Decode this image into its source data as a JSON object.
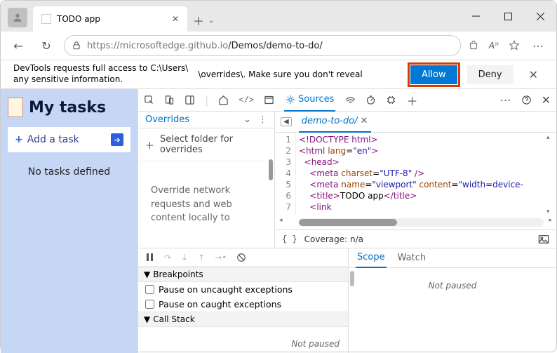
{
  "tab": {
    "title": "TODO app"
  },
  "url": {
    "prefix": "https://microsoftedge.github.io",
    "path": "/Demos/demo-to-do/"
  },
  "permission": {
    "line1": "DevTools requests full access to C:\\Users\\",
    "line2": "any sensitive information.",
    "line3": "\\overrides\\. Make sure you don't reveal",
    "allow": "Allow",
    "deny": "Deny"
  },
  "app": {
    "title": "My tasks",
    "add_label": "Add a task",
    "empty": "No tasks defined"
  },
  "devtools": {
    "sources_tab": "Sources",
    "overrides_tab": "Overrides",
    "select_folder": "Select folder for overrides",
    "override_desc": "Override network requests and web content locally to",
    "file_tab": "demo-to-do/",
    "coverage_label": "Coverage: n/a"
  },
  "code": {
    "lines": [
      1,
      2,
      3,
      4,
      5,
      6,
      7
    ],
    "html": "<!DOCTYPE html>\n<html lang=\"en\">\n  <head>\n    <meta charset=\"UTF-8\" />\n    <meta name=\"viewport\" content=\"width=device-\n    <title>TODO app</title>\n    <link"
  },
  "debugger": {
    "breakpoints": "Breakpoints",
    "uncaught": "Pause on uncaught exceptions",
    "caught": "Pause on caught exceptions",
    "callstack": "Call Stack",
    "not_paused": "Not paused",
    "scope": "Scope",
    "watch": "Watch"
  }
}
